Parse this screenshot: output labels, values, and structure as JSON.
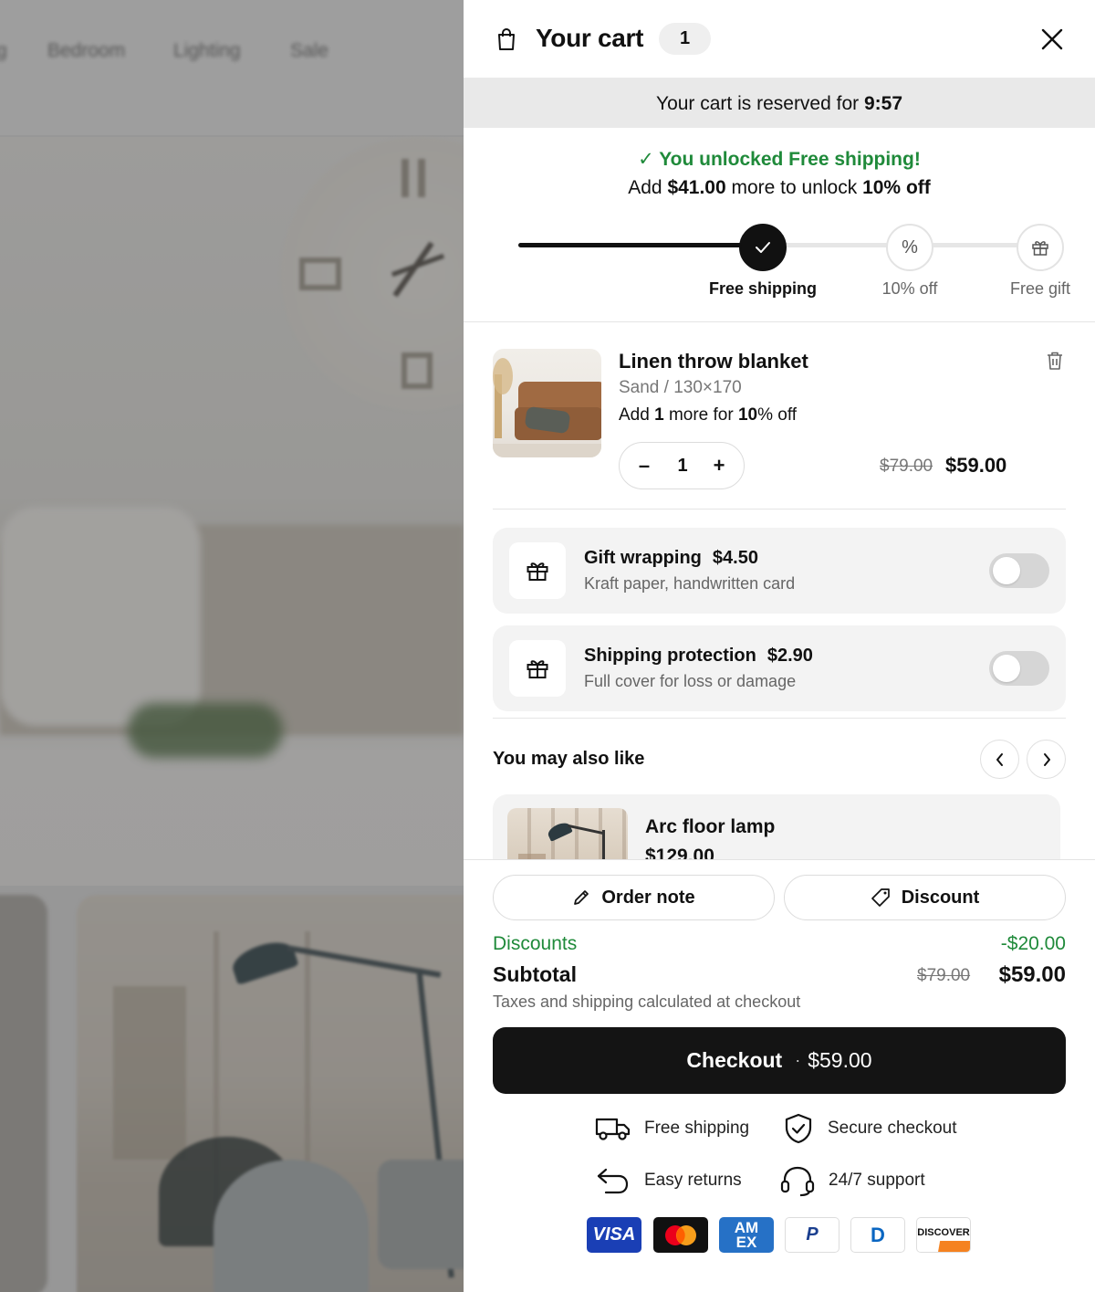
{
  "background": {
    "nav": [
      "g",
      "Bedroom",
      "Lighting",
      "Sale"
    ]
  },
  "cart": {
    "title": "Your cart",
    "count": "1",
    "reserved_prefix": "Your cart is reserved for ",
    "reserved_time": "9:57",
    "unlock_message": "✓ You unlocked Free shipping!",
    "unlock_sub_prefix": "Add ",
    "unlock_sub_amount": "$41.00",
    "unlock_sub_middle": " more to unlock ",
    "unlock_sub_reward": "10% off",
    "progress_fraction": 0.47,
    "milestones": [
      {
        "label": "Free shipping",
        "icon": "check-icon",
        "reached": true
      },
      {
        "label": "10% off",
        "icon": "percent-icon",
        "reached": false
      },
      {
        "label": "Free gift",
        "icon": "gift-icon",
        "reached": false
      }
    ]
  },
  "item": {
    "name": "Linen throw blanket",
    "variant": "Sand / 130×170",
    "promo_prefix": "Add ",
    "promo_qty": "1",
    "promo_middle": " more for ",
    "promo_reward": "10",
    "promo_suffix": "% off",
    "quantity": "1",
    "minus": "–",
    "plus": "+",
    "old_price": "$79.00",
    "price": "$59.00"
  },
  "addons": [
    {
      "title": "Gift wrapping",
      "price": "$4.50",
      "subtitle": "Kraft paper, handwritten card",
      "enabled": false
    },
    {
      "title": "Shipping protection",
      "price": "$2.90",
      "subtitle": "Full cover for loss or damage",
      "enabled": false
    }
  ],
  "recommendations": {
    "heading": "You may also like",
    "items": [
      {
        "name": "Arc floor lamp",
        "price": "$129.00"
      }
    ]
  },
  "footer": {
    "order_note": "Order note",
    "discount": "Discount",
    "discounts_label": "Discounts",
    "discounts_value": "-$20.00",
    "subtotal_label": "Subtotal",
    "subtotal_old": "$79.00",
    "subtotal_value": "$59.00",
    "tax_note": "Taxes and shipping calculated at checkout",
    "checkout_label": "Checkout",
    "checkout_dot": "·",
    "checkout_amount": "$59.00",
    "trust": [
      {
        "label": "Free shipping",
        "icon": "truck-icon"
      },
      {
        "label": "Secure checkout",
        "icon": "shield-icon"
      },
      {
        "label": "Easy returns",
        "icon": "return-icon"
      },
      {
        "label": "24/7 support",
        "icon": "headset-icon"
      }
    ],
    "payments": {
      "visa": "VISA",
      "mastercard": "",
      "amex_top": "AM",
      "amex_bottom": "EX",
      "paypal": "P",
      "diners": "D",
      "discover": "DISCOVER"
    }
  },
  "colors": {
    "success": "#1f8a3a",
    "primary": "#141414",
    "visa": "#1a3fb5",
    "amex": "#2671c6",
    "discover_orange": "#f58220"
  }
}
